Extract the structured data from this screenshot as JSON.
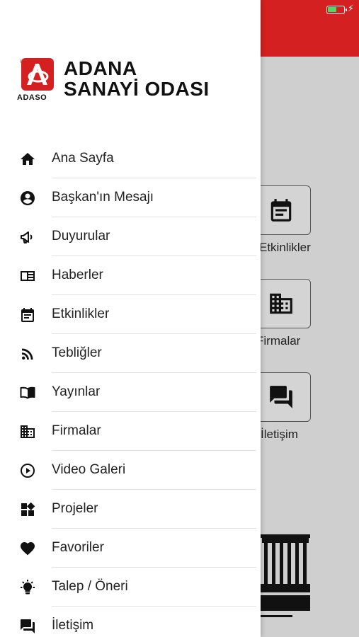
{
  "background": {
    "header_color": "#d42020",
    "battery_level": 0.55,
    "tiles": [
      {
        "label": "Etkinlikler",
        "icon": "calendar-icon"
      },
      {
        "label": "Firmalar",
        "icon": "buildings-icon"
      },
      {
        "label": "İletişim",
        "icon": "chat-icon"
      }
    ]
  },
  "drawer": {
    "logo": {
      "line1": "ADANA",
      "line2": "SANAYİ ODASI",
      "abbr": "ADASO"
    },
    "items": [
      {
        "label": "Ana Sayfa",
        "icon": "home-icon"
      },
      {
        "label": "Başkan'ın Mesajı",
        "icon": "account-circle-icon"
      },
      {
        "label": "Duyurular",
        "icon": "megaphone-icon"
      },
      {
        "label": "Haberler",
        "icon": "newspaper-icon"
      },
      {
        "label": "Etkinlikler",
        "icon": "calendar-icon"
      },
      {
        "label": "Tebliğler",
        "icon": "rss-icon"
      },
      {
        "label": "Yayınlar",
        "icon": "book-open-icon"
      },
      {
        "label": "Firmalar",
        "icon": "buildings-icon"
      },
      {
        "label": "Video Galeri",
        "icon": "play-circle-icon"
      },
      {
        "label": "Projeler",
        "icon": "widgets-icon"
      },
      {
        "label": "Favoriler",
        "icon": "heart-icon"
      },
      {
        "label": "Talep / Öneri",
        "icon": "lightbulb-icon"
      },
      {
        "label": "İletişim",
        "icon": "chat-icon"
      }
    ]
  }
}
